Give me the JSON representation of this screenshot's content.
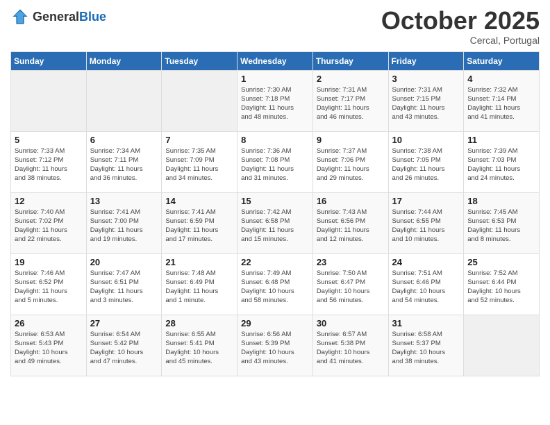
{
  "logo": {
    "general": "General",
    "blue": "Blue"
  },
  "header": {
    "month": "October 2025",
    "location": "Cercal, Portugal"
  },
  "days_of_week": [
    "Sunday",
    "Monday",
    "Tuesday",
    "Wednesday",
    "Thursday",
    "Friday",
    "Saturday"
  ],
  "weeks": [
    [
      {
        "day": "",
        "info": ""
      },
      {
        "day": "",
        "info": ""
      },
      {
        "day": "",
        "info": ""
      },
      {
        "day": "1",
        "info": "Sunrise: 7:30 AM\nSunset: 7:18 PM\nDaylight: 11 hours\nand 48 minutes."
      },
      {
        "day": "2",
        "info": "Sunrise: 7:31 AM\nSunset: 7:17 PM\nDaylight: 11 hours\nand 46 minutes."
      },
      {
        "day": "3",
        "info": "Sunrise: 7:31 AM\nSunset: 7:15 PM\nDaylight: 11 hours\nand 43 minutes."
      },
      {
        "day": "4",
        "info": "Sunrise: 7:32 AM\nSunset: 7:14 PM\nDaylight: 11 hours\nand 41 minutes."
      }
    ],
    [
      {
        "day": "5",
        "info": "Sunrise: 7:33 AM\nSunset: 7:12 PM\nDaylight: 11 hours\nand 38 minutes."
      },
      {
        "day": "6",
        "info": "Sunrise: 7:34 AM\nSunset: 7:11 PM\nDaylight: 11 hours\nand 36 minutes."
      },
      {
        "day": "7",
        "info": "Sunrise: 7:35 AM\nSunset: 7:09 PM\nDaylight: 11 hours\nand 34 minutes."
      },
      {
        "day": "8",
        "info": "Sunrise: 7:36 AM\nSunset: 7:08 PM\nDaylight: 11 hours\nand 31 minutes."
      },
      {
        "day": "9",
        "info": "Sunrise: 7:37 AM\nSunset: 7:06 PM\nDaylight: 11 hours\nand 29 minutes."
      },
      {
        "day": "10",
        "info": "Sunrise: 7:38 AM\nSunset: 7:05 PM\nDaylight: 11 hours\nand 26 minutes."
      },
      {
        "day": "11",
        "info": "Sunrise: 7:39 AM\nSunset: 7:03 PM\nDaylight: 11 hours\nand 24 minutes."
      }
    ],
    [
      {
        "day": "12",
        "info": "Sunrise: 7:40 AM\nSunset: 7:02 PM\nDaylight: 11 hours\nand 22 minutes."
      },
      {
        "day": "13",
        "info": "Sunrise: 7:41 AM\nSunset: 7:00 PM\nDaylight: 11 hours\nand 19 minutes."
      },
      {
        "day": "14",
        "info": "Sunrise: 7:41 AM\nSunset: 6:59 PM\nDaylight: 11 hours\nand 17 minutes."
      },
      {
        "day": "15",
        "info": "Sunrise: 7:42 AM\nSunset: 6:58 PM\nDaylight: 11 hours\nand 15 minutes."
      },
      {
        "day": "16",
        "info": "Sunrise: 7:43 AM\nSunset: 6:56 PM\nDaylight: 11 hours\nand 12 minutes."
      },
      {
        "day": "17",
        "info": "Sunrise: 7:44 AM\nSunset: 6:55 PM\nDaylight: 11 hours\nand 10 minutes."
      },
      {
        "day": "18",
        "info": "Sunrise: 7:45 AM\nSunset: 6:53 PM\nDaylight: 11 hours\nand 8 minutes."
      }
    ],
    [
      {
        "day": "19",
        "info": "Sunrise: 7:46 AM\nSunset: 6:52 PM\nDaylight: 11 hours\nand 5 minutes."
      },
      {
        "day": "20",
        "info": "Sunrise: 7:47 AM\nSunset: 6:51 PM\nDaylight: 11 hours\nand 3 minutes."
      },
      {
        "day": "21",
        "info": "Sunrise: 7:48 AM\nSunset: 6:49 PM\nDaylight: 11 hours\nand 1 minute."
      },
      {
        "day": "22",
        "info": "Sunrise: 7:49 AM\nSunset: 6:48 PM\nDaylight: 10 hours\nand 58 minutes."
      },
      {
        "day": "23",
        "info": "Sunrise: 7:50 AM\nSunset: 6:47 PM\nDaylight: 10 hours\nand 56 minutes."
      },
      {
        "day": "24",
        "info": "Sunrise: 7:51 AM\nSunset: 6:46 PM\nDaylight: 10 hours\nand 54 minutes."
      },
      {
        "day": "25",
        "info": "Sunrise: 7:52 AM\nSunset: 6:44 PM\nDaylight: 10 hours\nand 52 minutes."
      }
    ],
    [
      {
        "day": "26",
        "info": "Sunrise: 6:53 AM\nSunset: 5:43 PM\nDaylight: 10 hours\nand 49 minutes."
      },
      {
        "day": "27",
        "info": "Sunrise: 6:54 AM\nSunset: 5:42 PM\nDaylight: 10 hours\nand 47 minutes."
      },
      {
        "day": "28",
        "info": "Sunrise: 6:55 AM\nSunset: 5:41 PM\nDaylight: 10 hours\nand 45 minutes."
      },
      {
        "day": "29",
        "info": "Sunrise: 6:56 AM\nSunset: 5:39 PM\nDaylight: 10 hours\nand 43 minutes."
      },
      {
        "day": "30",
        "info": "Sunrise: 6:57 AM\nSunset: 5:38 PM\nDaylight: 10 hours\nand 41 minutes."
      },
      {
        "day": "31",
        "info": "Sunrise: 6:58 AM\nSunset: 5:37 PM\nDaylight: 10 hours\nand 38 minutes."
      },
      {
        "day": "",
        "info": ""
      }
    ]
  ]
}
